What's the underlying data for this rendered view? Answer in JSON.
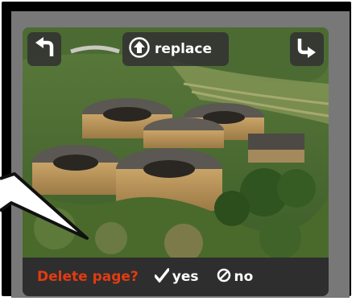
{
  "toolbar": {
    "rotate_left_icon": "rotate-left-icon",
    "rotate_right_icon": "rotate-right-icon",
    "replace_label": "replace",
    "replace_icon": "upload-circle-icon"
  },
  "confirm": {
    "question": "Delete page?",
    "yes_label": "yes",
    "no_label": "no",
    "yes_icon": "checkmark-icon",
    "no_icon": "prohibited-icon"
  },
  "colors": {
    "accent_red": "#e33b12",
    "bar_bg": "#2e2e2e",
    "panel_bg": "#787878"
  }
}
